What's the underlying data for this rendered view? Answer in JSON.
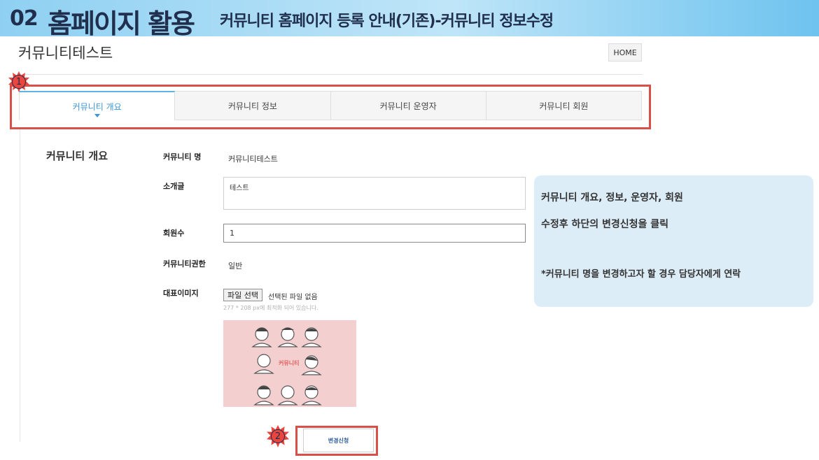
{
  "banner": {
    "number": "02",
    "title": "홈페이지 활용",
    "subtitle": "커뮤니티 홈페이지 등록 안내(기존)-커뮤니티 정보수정"
  },
  "page": {
    "title": "커뮤니티테스트",
    "home_label": "HOME"
  },
  "tabs": [
    {
      "label": "커뮤니티 개요",
      "active": true
    },
    {
      "label": "커뮤니티 정보",
      "active": false
    },
    {
      "label": "커뮤니티 운영자",
      "active": false
    },
    {
      "label": "커뮤니티 회원",
      "active": false
    }
  ],
  "markers": {
    "one": "1",
    "two": "2"
  },
  "form": {
    "section_title": "커뮤니티 개요",
    "name_label": "커뮤니티 명",
    "name_value": "커뮤니티테스트",
    "intro_label": "소개글",
    "intro_value": "테스트",
    "members_label": "회원수",
    "members_value": "1",
    "authority_label": "커뮤니티권한",
    "authority_value": "일반",
    "image_label": "대표이미지",
    "file_button": "파일 선택",
    "file_status": "선택된 파일 없음",
    "file_hint": "277 * 208 px에 최적화 되어 있습니다.",
    "image_caption": "커뮤니티",
    "submit_label": "변경신청"
  },
  "callout": {
    "line1": "커뮤니티 개요, 정보, 운영자, 회원",
    "line2": "수정후 하단의 변경신청을 클릭",
    "line3": "*커뮤니티 명을 변경하고자 할 경우 담당자에게 연락"
  },
  "colors": {
    "accent": "#3c95d6",
    "highlight": "#d9504b",
    "banner": "#8fd0f2",
    "callout_bg": "#dcedf8"
  }
}
